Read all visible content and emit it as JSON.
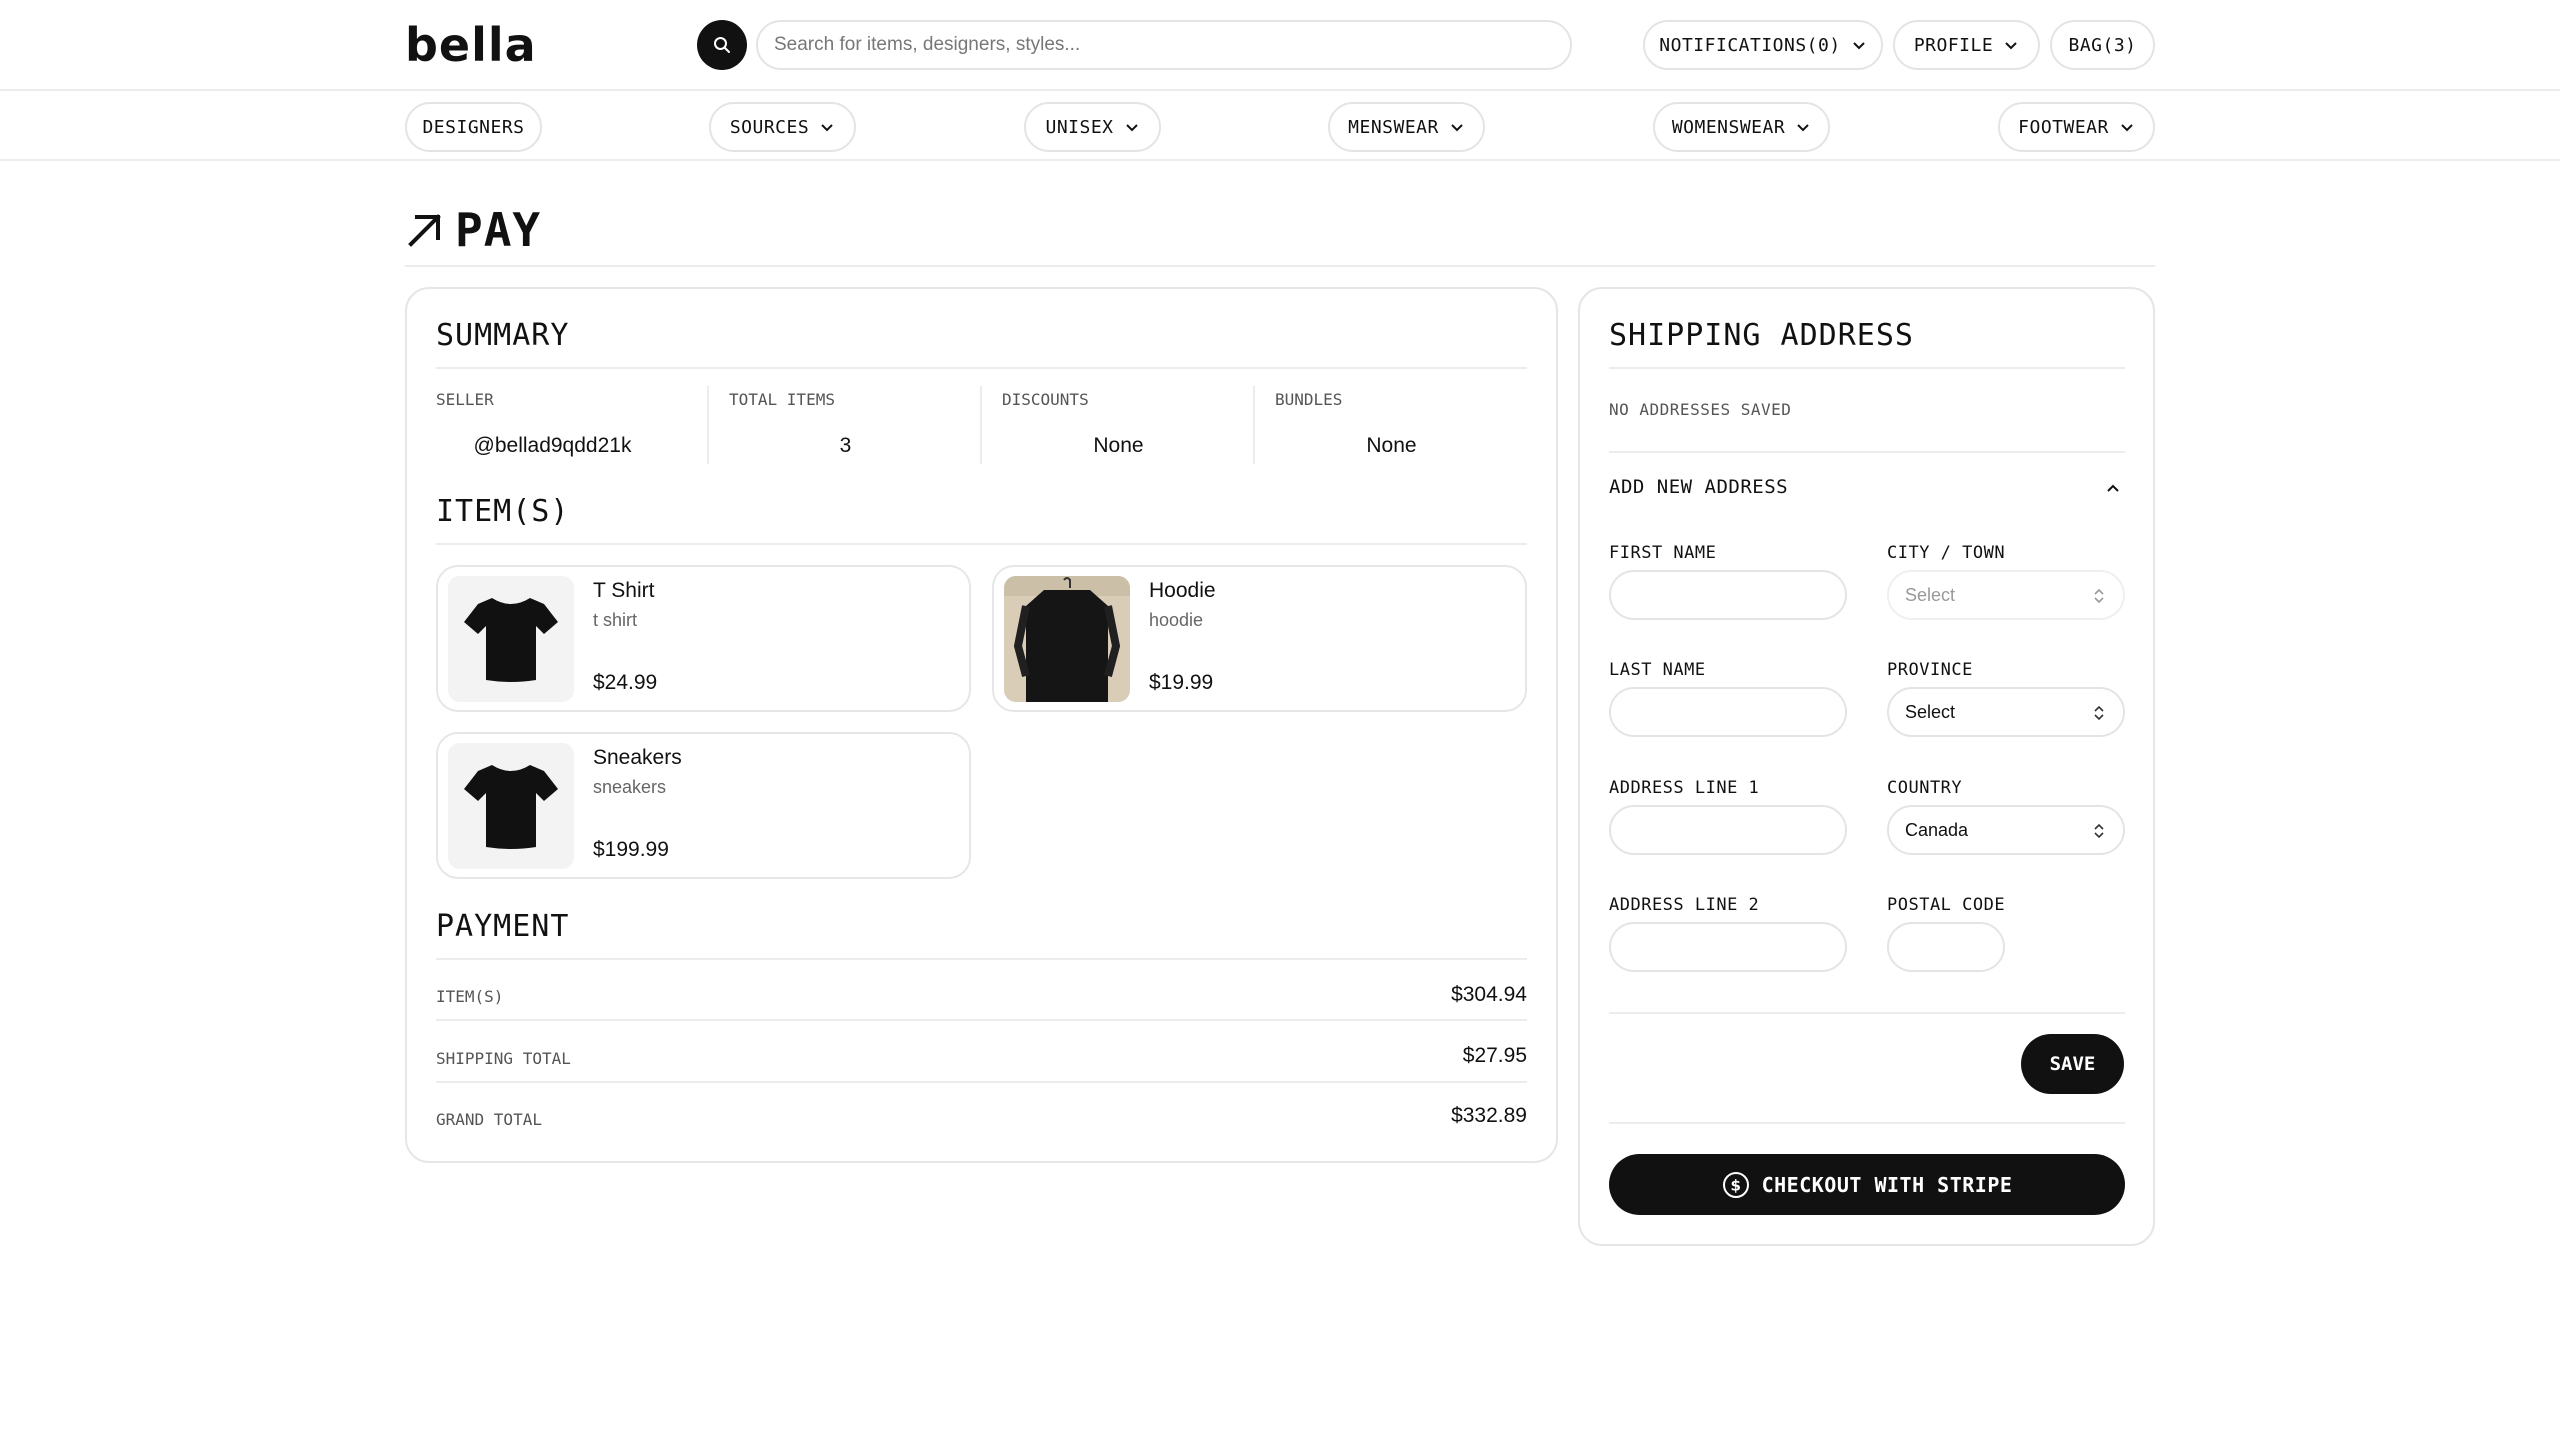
{
  "header": {
    "logo_text": "bella",
    "search_placeholder": "Search for items, designers, styles...",
    "notifications_label": "NOTIFICATIONS(0)",
    "profile_label": "PROFILE",
    "bag_label": "BAG(3)"
  },
  "categories": [
    {
      "label": "DESIGNERS",
      "has_dropdown": false
    },
    {
      "label": "SOURCES",
      "has_dropdown": true
    },
    {
      "label": "UNISEX",
      "has_dropdown": true
    },
    {
      "label": "MENSWEAR",
      "has_dropdown": true
    },
    {
      "label": "WOMENSWEAR",
      "has_dropdown": true
    },
    {
      "label": "FOOTWEAR",
      "has_dropdown": true
    }
  ],
  "page": {
    "title": "PAY",
    "title_icon": "arrow-up-right-icon"
  },
  "summary": {
    "heading": "SUMMARY",
    "seller_label": "SELLER",
    "seller_value": "@bellad9qdd21k",
    "total_items_label": "TOTAL ITEMS",
    "total_items_value": "3",
    "discounts_label": "DISCOUNTS",
    "discounts_value": "None",
    "bundles_label": "BUNDLES",
    "bundles_value": "None"
  },
  "items": {
    "heading": "ITEM(S)",
    "list": [
      {
        "name": "T Shirt",
        "subtitle": "t shirt",
        "price": "$24.99",
        "thumb": "black-tshirt"
      },
      {
        "name": "Hoodie",
        "subtitle": "hoodie",
        "price": "$19.99",
        "thumb": "hanging-black-garment"
      },
      {
        "name": "Sneakers",
        "subtitle": "sneakers",
        "price": "$199.99",
        "thumb": "black-tshirt"
      }
    ]
  },
  "payment": {
    "heading": "PAYMENT",
    "items_label": "ITEM(S)",
    "items_value": "$304.94",
    "shipping_label": "SHIPPING TOTAL",
    "shipping_value": "$27.95",
    "grand_label": "GRAND TOTAL",
    "grand_value": "$332.89"
  },
  "shipping": {
    "heading": "SHIPPING ADDRESS",
    "no_addresses": "NO ADDRESSES SAVED",
    "add_new_label": "ADD NEW ADDRESS",
    "first_name_label": "FIRST NAME",
    "last_name_label": "LAST NAME",
    "address1_label": "ADDRESS LINE 1",
    "address2_label": "ADDRESS LINE 2",
    "city_label": "CITY / TOWN",
    "city_value": "Select",
    "province_label": "PROVINCE",
    "province_value": "Select",
    "country_label": "COUNTRY",
    "country_value": "Canada",
    "postal_label": "POSTAL CODE",
    "save_label": "SAVE",
    "checkout_label": "CHECKOUT WITH STRIPE"
  },
  "colors": {
    "primary": "#111111",
    "border": "#e6e6e6",
    "muted_text": "#555555",
    "background": "#ffffff"
  }
}
